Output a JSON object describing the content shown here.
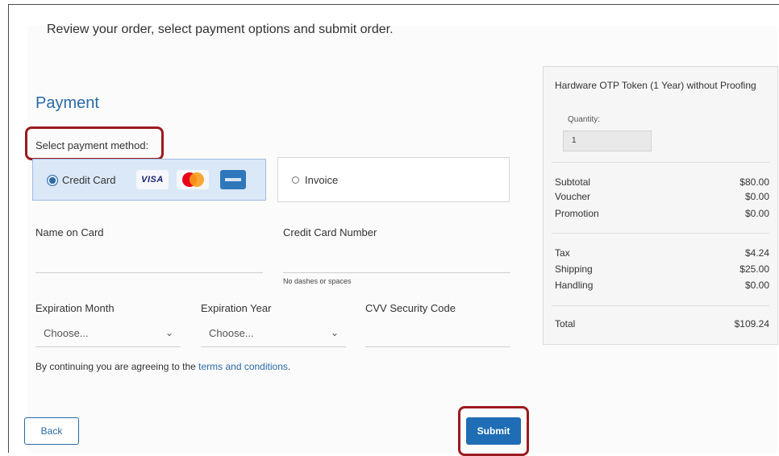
{
  "intro_text": "Review your order, select payment options and submit order.",
  "payment": {
    "title": "Payment",
    "method_label": "Select payment method:",
    "methods": [
      {
        "label": "Credit Card",
        "selected": true,
        "card_logos": [
          "VISA",
          "mastercard-icon",
          "amex-icon"
        ]
      },
      {
        "label": "Invoice",
        "selected": false
      }
    ],
    "fields": {
      "name_on_card": {
        "label": "Name on Card",
        "value": ""
      },
      "card_number": {
        "label": "Credit Card Number",
        "value": "",
        "hint": "No dashes or spaces"
      },
      "exp_month": {
        "label": "Expiration Month",
        "value": "Choose..."
      },
      "exp_year": {
        "label": "Expiration Year",
        "value": "Choose..."
      },
      "cvv": {
        "label": "CVV Security Code",
        "value": ""
      }
    },
    "terms_prefix": "By continuing you are agreeing to the ",
    "terms_link": "terms and conditions",
    "terms_suffix": "."
  },
  "buttons": {
    "back": "Back",
    "submit": "Submit"
  },
  "summary": {
    "product": "Hardware OTP Token (1 Year) without Proofing",
    "quantity_label": "Quantity:",
    "quantity_value": "1",
    "rows": [
      {
        "label": "Subtotal",
        "value": "$80.00"
      },
      {
        "label": "Voucher",
        "value": "$0.00"
      },
      {
        "label": "Promotion",
        "value": "$0.00"
      },
      {
        "label": "Tax",
        "value": "$4.24"
      },
      {
        "label": "Shipping",
        "value": "$25.00"
      },
      {
        "label": "Handling",
        "value": "$0.00"
      },
      {
        "label": "Total",
        "value": "$109.24"
      }
    ]
  },
  "colors": {
    "accent": "#2b6aa6",
    "highlight": "#9b1b1f",
    "submit": "#1f6db5"
  }
}
